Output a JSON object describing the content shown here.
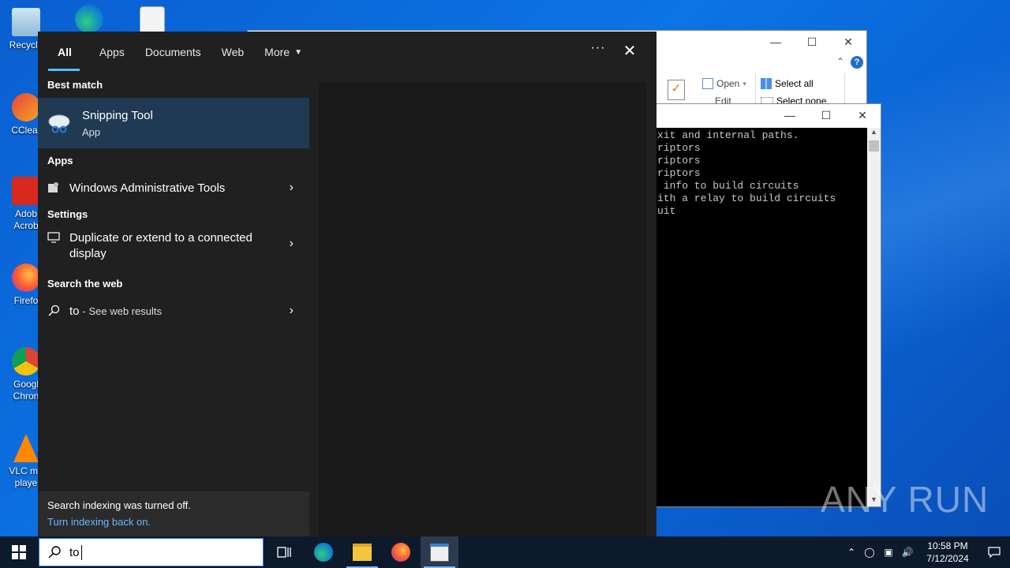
{
  "desktop": {
    "icons": [
      {
        "label": "Recycle",
        "icon": "recycle-bin-icon"
      },
      {
        "label": "CClear",
        "icon": "ccleaner-icon"
      },
      {
        "label": "Adob\nAcrob",
        "icon": "adobe-acrobat-icon"
      },
      {
        "label": "Firefo",
        "icon": "firefox-icon"
      },
      {
        "label": "Googl\nChron",
        "icon": "chrome-icon"
      },
      {
        "label": "VLC me\nplaye",
        "icon": "vlc-icon"
      }
    ]
  },
  "explorer": {
    "ribbon": {
      "open": "Open",
      "edit": "Edit",
      "select_all": "Select all",
      "select_none": "Select none"
    }
  },
  "console": {
    "lines": [
      "xit and internal paths.",
      "riptors",
      "riptors",
      "riptors",
      " info to build circuits",
      "ith a relay to build circuits",
      "uit"
    ]
  },
  "search": {
    "tabs": [
      "All",
      "Apps",
      "Documents",
      "Web",
      "More"
    ],
    "best_match_heading": "Best match",
    "best_match": {
      "title": "Snipping Tool",
      "subtitle": "App"
    },
    "apps_heading": "Apps",
    "apps": [
      {
        "label": "Windows Administrative Tools"
      }
    ],
    "settings_heading": "Settings",
    "settings": [
      {
        "label": "Duplicate or extend to a connected display"
      }
    ],
    "web_heading": "Search the web",
    "web": {
      "query": "to",
      "suffix": "- See web results"
    },
    "footer": {
      "message": "Search indexing was turned off.",
      "link": "Turn indexing back on."
    },
    "query": "to"
  },
  "taskbar": {
    "time": "10:58 PM",
    "date": "7/12/2024"
  },
  "watermark": "ANY RUN",
  "colors": {
    "accent": "#4cc2ff",
    "selected_row": "#1f3a52",
    "panel": "#202020"
  }
}
